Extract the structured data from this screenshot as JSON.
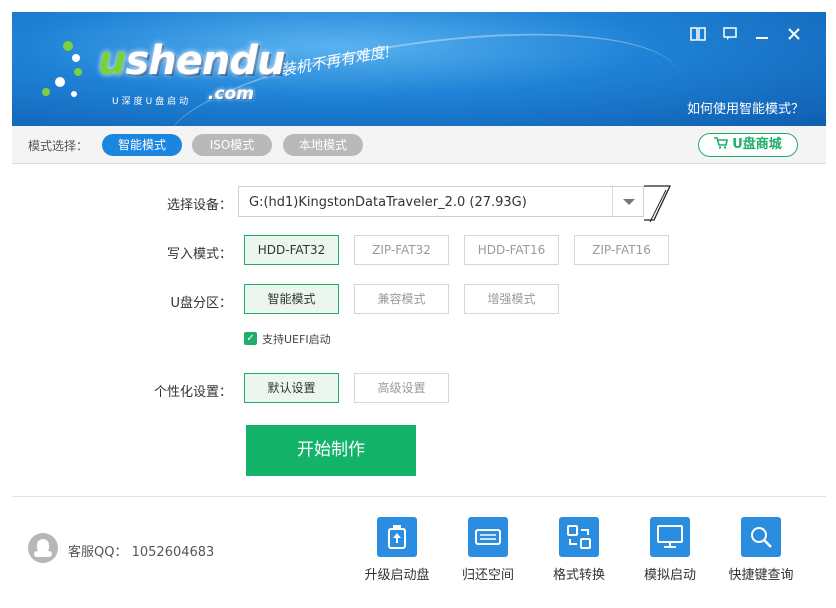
{
  "header": {
    "logo_u": "u",
    "logo_rest": "shendu",
    "logo_sub": "U深度U盘启动",
    "logo_com": ".com",
    "slogan": "装机不再有难度!",
    "help_link": "如何使用智能模式？",
    "window_buttons": [
      "book-icon",
      "chat-icon",
      "minimize-icon",
      "close-icon"
    ]
  },
  "modebar": {
    "label": "模式选择：",
    "modes": [
      "智能模式",
      "ISO模式",
      "本地模式"
    ],
    "active_mode": "智能模式",
    "shop_label": "U盘商城"
  },
  "form": {
    "device_label": "选择设备：",
    "device_value": "G:(hd1)KingstonDataTraveler_2.0 (27.93G)",
    "write_label": "写入模式：",
    "write_modes": [
      "HDD-FAT32",
      "ZIP-FAT32",
      "HDD-FAT16",
      "ZIP-FAT16"
    ],
    "partition_label": "U盘分区：",
    "partition_modes": [
      "智能模式",
      "兼容模式",
      "增强模式"
    ],
    "uefi_label": "支持UEFI启动",
    "uefi_checked": true,
    "custom_label": "个性化设置：",
    "custom_modes": [
      "默认设置",
      "高级设置"
    ],
    "start_label": "开始制作"
  },
  "footer": {
    "qq_label": "客服QQ：",
    "qq_number": "1052604683",
    "tools": [
      "升级启动盘",
      "归还空间",
      "格式转换",
      "模拟启动",
      "快捷键查询"
    ]
  },
  "colors": {
    "header_blue": "#1f82d6",
    "accent_blue": "#1a86e0",
    "accent_green": "#14b36a"
  }
}
